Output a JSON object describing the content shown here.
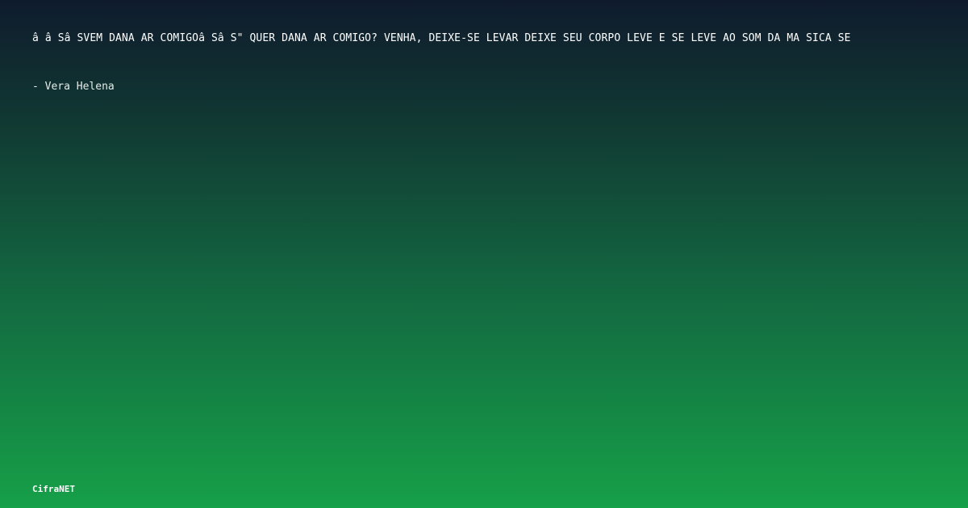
{
  "share_card": {
    "lyric_text": "â  â Śâ ŚVEM DANĂ AR COMIGOâ Śâ Ś\" QUER DANĂ AR COMIGO? VENHA, DEIXE-SE LEVAR DEIXE SEU CORPO LEVE E SE LEVE AO SOM DA MĂ SICA SE",
    "artist_attribution": "- Vera Helena",
    "brand_name": "CifraNET"
  },
  "colors": {
    "background_top": "#0f1b2d",
    "background_bottom": "#16a048",
    "text": "#ffffff"
  }
}
